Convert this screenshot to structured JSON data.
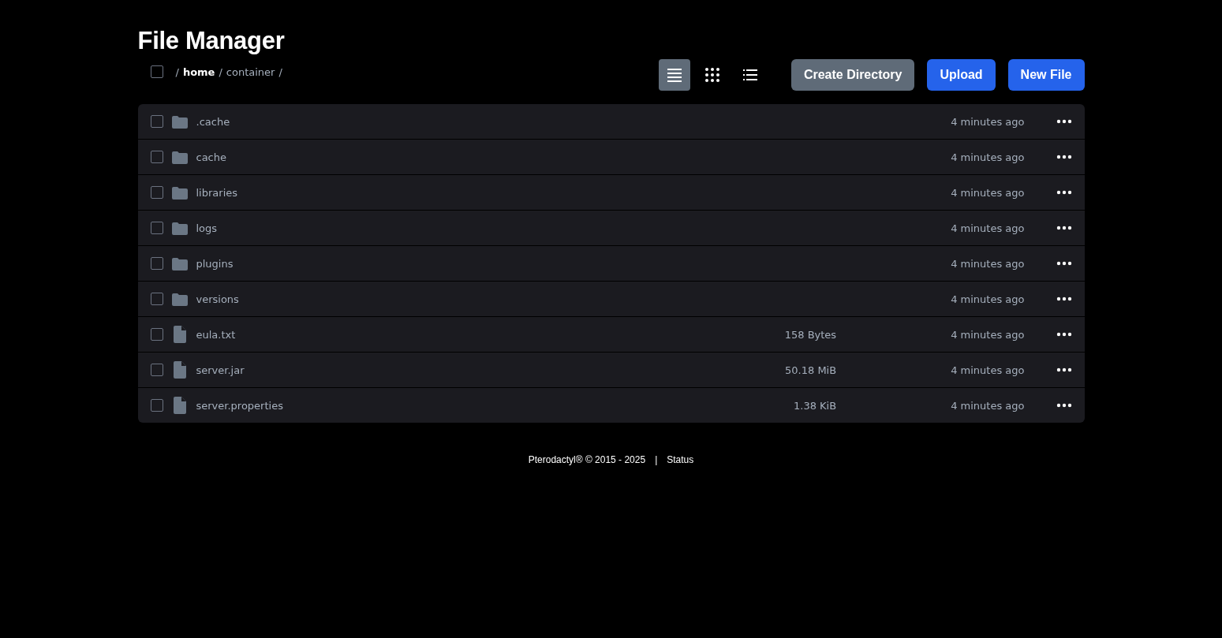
{
  "title": "File Manager",
  "breadcrumb": {
    "select_all_checked": false,
    "parts": [
      {
        "text": "/",
        "current": false
      },
      {
        "text": "home",
        "current": true
      },
      {
        "text": "/",
        "current": false
      },
      {
        "text": "container",
        "current": false
      },
      {
        "text": "/",
        "current": false
      }
    ]
  },
  "view_modes": [
    {
      "kind": "rows",
      "selected": true
    },
    {
      "kind": "grid",
      "selected": false
    },
    {
      "kind": "list",
      "selected": false
    }
  ],
  "buttons": [
    {
      "label": "Create Directory",
      "kind": "secondary"
    },
    {
      "label": "Upload",
      "kind": "primary"
    },
    {
      "label": "New File",
      "kind": "primary"
    }
  ],
  "files": [
    {
      "kind": "folder",
      "name": ".cache",
      "modified": "4 minutes ago",
      "checked": false
    },
    {
      "kind": "folder",
      "name": "cache",
      "modified": "4 minutes ago",
      "checked": false
    },
    {
      "kind": "folder",
      "name": "libraries",
      "modified": "4 minutes ago",
      "checked": false
    },
    {
      "kind": "folder",
      "name": "logs",
      "modified": "4 minutes ago",
      "checked": false
    },
    {
      "kind": "folder",
      "name": "plugins",
      "modified": "4 minutes ago",
      "checked": false
    },
    {
      "kind": "folder",
      "name": "versions",
      "modified": "4 minutes ago",
      "checked": false
    },
    {
      "kind": "file",
      "name": "eula.txt",
      "size": "158 Bytes",
      "modified": "4 minutes ago",
      "checked": false
    },
    {
      "kind": "file",
      "name": "server.jar",
      "size": "50.18 MiB",
      "modified": "4 minutes ago",
      "checked": false
    },
    {
      "kind": "file",
      "name": "server.properties",
      "size": "1.38 KiB",
      "modified": "4 minutes ago",
      "checked": false
    }
  ],
  "footer": {
    "copyright": "Pterodactyl® © 2015 - 2025",
    "separator": "|",
    "link": "Status"
  }
}
